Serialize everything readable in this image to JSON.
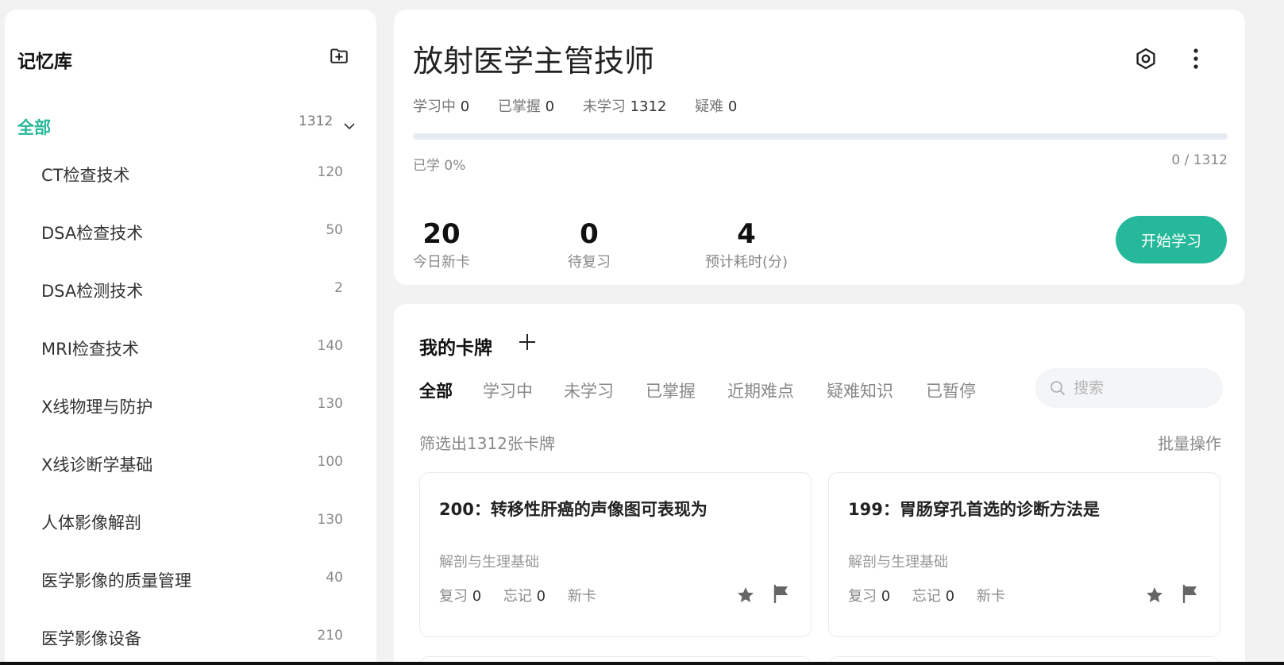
{
  "sidebar": {
    "title": "记忆库",
    "all": {
      "label": "全部",
      "count": "1312"
    },
    "items": [
      {
        "label": "CT检查技术",
        "count": "120"
      },
      {
        "label": "DSA检查技术",
        "count": "50"
      },
      {
        "label": "DSA检测技术",
        "count": "2"
      },
      {
        "label": "MRI检查技术",
        "count": "140"
      },
      {
        "label": "X线物理与防护",
        "count": "130"
      },
      {
        "label": "X线诊断学基础",
        "count": "100"
      },
      {
        "label": "人体影像解剖",
        "count": "130"
      },
      {
        "label": "医学影像的质量管理",
        "count": "40"
      },
      {
        "label": "医学影像设备",
        "count": "210"
      }
    ]
  },
  "deck": {
    "title": "放射医学主管技师",
    "stats": [
      {
        "label": "学习中",
        "value": "0"
      },
      {
        "label": "已掌握",
        "value": "0"
      },
      {
        "label": "未学习",
        "value": "1312"
      },
      {
        "label": "疑难",
        "value": "0"
      }
    ],
    "progress_fraction": 0,
    "progress_label": "已学 0%",
    "progress_count": "0 / 1312",
    "metrics": [
      {
        "value": "20",
        "label": "今日新卡"
      },
      {
        "value": "0",
        "label": "待复习"
      },
      {
        "value": "4",
        "label": "预计耗时(分)"
      }
    ],
    "start_label": "开始学习"
  },
  "cards": {
    "title": "我的卡牌",
    "tabs": [
      "全部",
      "学习中",
      "未学习",
      "已掌握",
      "近期难点",
      "疑难知识",
      "已暂停"
    ],
    "active_tab": "全部",
    "search_placeholder": "搜索",
    "filter_text": "筛选出1312张卡牌",
    "batch_label": "批量操作",
    "list": [
      {
        "question": "200：转移性肝癌的声像图可表现为",
        "category": "解剖与生理基础",
        "review_label": "复习",
        "review": "0",
        "forget_label": "忘记",
        "forget": "0",
        "status": "新卡"
      },
      {
        "question": "199：胃肠穿孔首选的诊断方法是",
        "category": "解剖与生理基础",
        "review_label": "复习",
        "review": "0",
        "forget_label": "忘记",
        "forget": "0",
        "status": "新卡"
      }
    ]
  },
  "colors": {
    "accent": "#26b89a",
    "background": "#f2f2f2",
    "panel": "#ffffff",
    "icon": "#666666"
  },
  "icons": [
    "folder-add-icon",
    "chevron-down-icon",
    "target-icon",
    "more-vertical-icon",
    "plus-icon",
    "search-icon",
    "star-icon",
    "flag-icon"
  ]
}
